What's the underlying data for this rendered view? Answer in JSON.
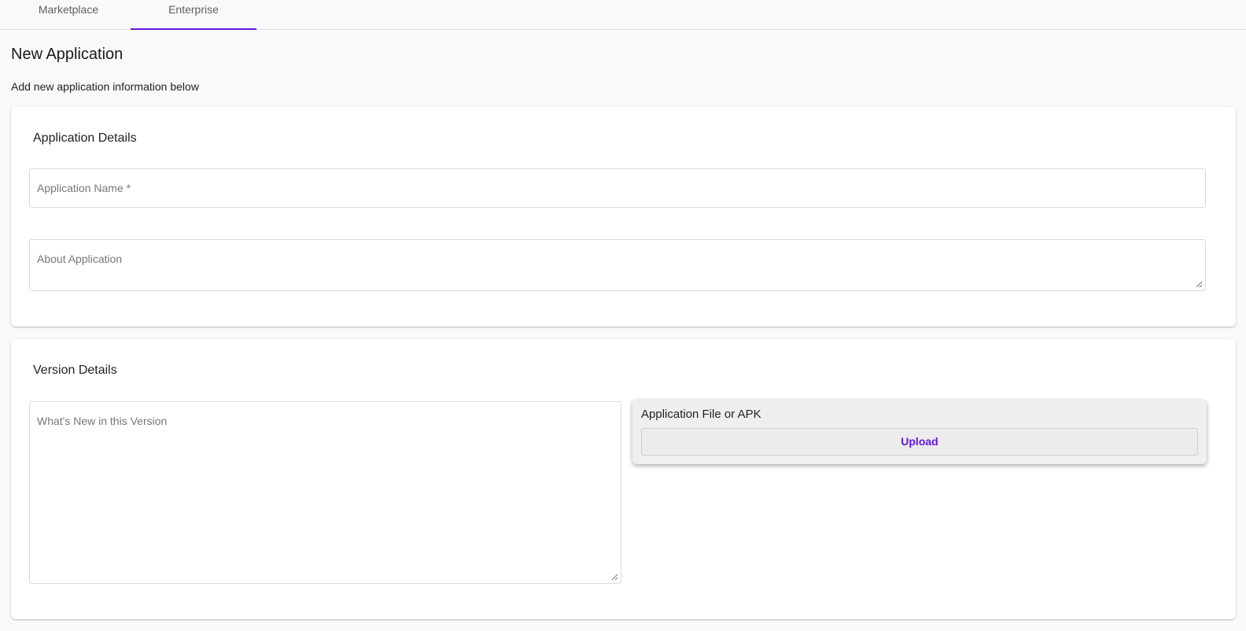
{
  "tabs": [
    {
      "label": "Marketplace",
      "active": false
    },
    {
      "label": "Enterprise",
      "active": true
    }
  ],
  "page": {
    "title": "New Application",
    "subtitle": "Add new application information below"
  },
  "application_details": {
    "title": "Application Details",
    "name_placeholder": "Application Name *",
    "about_placeholder": "About Application"
  },
  "version_details": {
    "title": "Version Details",
    "whats_new_placeholder": "What's New in this Version",
    "upload": {
      "title": "Application File or APK",
      "button_label": "Upload"
    }
  },
  "colors": {
    "accent": "#6418d8",
    "background": "#f9f9f9",
    "card": "#ffffff"
  }
}
